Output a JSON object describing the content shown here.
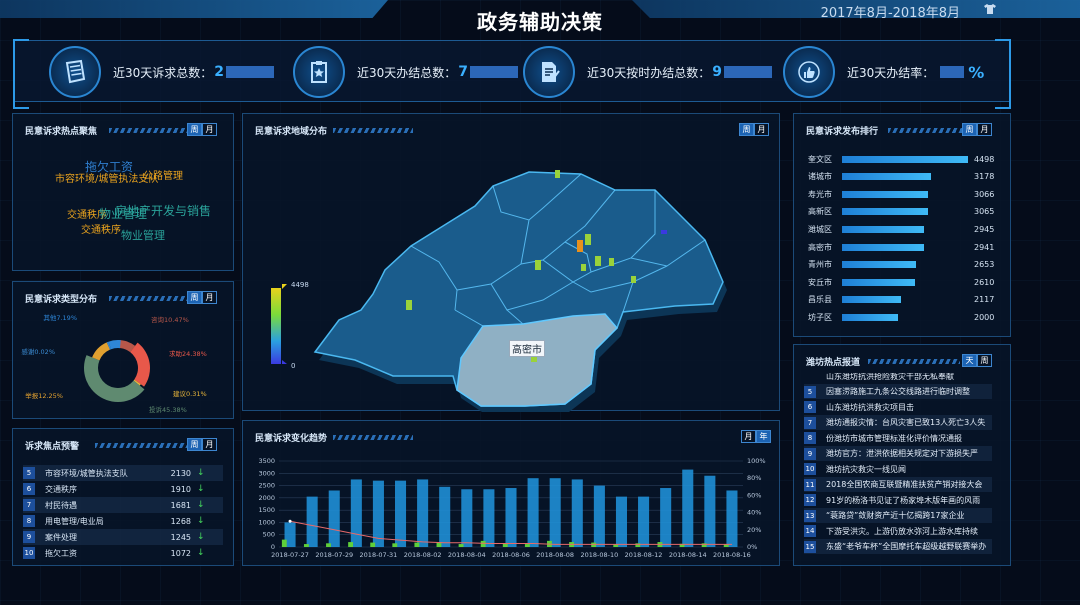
{
  "header": {
    "title": "政务辅助决策",
    "date_range": "2017年8月-2018年8月"
  },
  "stats": [
    {
      "label": "近30天诉求总数：",
      "value": "2",
      "icon": "scroll-icon"
    },
    {
      "label": "近30天办结总数：",
      "value": "7",
      "icon": "clipboard-star-icon"
    },
    {
      "label": "近30天按时办结总数：",
      "value": "9",
      "icon": "document-pen-icon"
    },
    {
      "label": "近30天办结率：",
      "value": "%",
      "icon": "thumbs-up-icon"
    }
  ],
  "hotspot": {
    "title": "民意诉求热点聚焦",
    "tabs": [
      "周",
      "月"
    ],
    "words": [
      {
        "text": "拖欠工资",
        "color": "#2f7fd0"
      },
      {
        "text": "市容环境/城管执法支队",
        "color": "#e8a21e"
      },
      {
        "text": "公路管理",
        "color": "#e8a21e"
      },
      {
        "text": "房地产开发与销售",
        "color": "#2aa39a"
      },
      {
        "text": "交通秩序",
        "color": "#e8a21e"
      },
      {
        "text": "物业管理",
        "color": "#2aa39a"
      },
      {
        "text": "交通秩序",
        "color": "#e8a21e"
      },
      {
        "text": "物业管理",
        "color": "#2aa39a"
      }
    ]
  },
  "type_dist": {
    "title": "民意诉求类型分布",
    "tabs": [
      "周",
      "月"
    ],
    "chart_data": {
      "type": "pie",
      "slices": [
        {
          "name": "咨询",
          "value": 10.47,
          "label": "咨询10.47%",
          "color": "#b8574a"
        },
        {
          "name": "求助",
          "value": 24.38,
          "label": "求助24.38%",
          "color": "#e8584a"
        },
        {
          "name": "建议",
          "value": 0.31,
          "label": "建议0.31%",
          "color": "#e8b53a"
        },
        {
          "name": "投诉",
          "value": 45.38,
          "label": "投诉45.38%",
          "color": "#5f8a70"
        },
        {
          "name": "举报",
          "value": 12.25,
          "label": "举报12.25%",
          "color": "#e0a030"
        },
        {
          "name": "感谢",
          "value": 0.02,
          "label": "感谢0.02%",
          "color": "#3a8ad0"
        },
        {
          "name": "其他",
          "value": 7.19,
          "label": "其他7.19%",
          "color": "#2e86d8"
        }
      ]
    }
  },
  "warning": {
    "title": "诉求焦点预警",
    "tabs": [
      "周",
      "月"
    ],
    "rows": [
      {
        "rank": "5",
        "name": "市容环境/城管执法支队",
        "value": "2130"
      },
      {
        "rank": "6",
        "name": "交通秩序",
        "value": "1910"
      },
      {
        "rank": "7",
        "name": "村民待遇",
        "value": "1681"
      },
      {
        "rank": "8",
        "name": "用电管理/电业局",
        "value": "1268"
      },
      {
        "rank": "9",
        "name": "案件处理",
        "value": "1245"
      },
      {
        "rank": "10",
        "name": "拖欠工资",
        "value": "1072"
      }
    ]
  },
  "map": {
    "title": "民意诉求地域分布",
    "tabs": [
      "周",
      "月"
    ],
    "legend_max": "4498",
    "legend_min": "0",
    "highlight_label": "高密市"
  },
  "trend": {
    "title": "民意诉求变化趋势",
    "tabs": [
      "月",
      "年"
    ],
    "chart_data": {
      "type": "bar",
      "x_tick_labels": [
        "2018-07-27",
        "2018-07-29",
        "2018-07-31",
        "2018-08-02",
        "2018-08-04",
        "2018-08-06",
        "2018-08-08",
        "2018-08-10",
        "2018-08-12",
        "2018-08-14",
        "2018-08-16"
      ],
      "categories": [
        "2018-07-27",
        "2018-07-28",
        "2018-07-29",
        "2018-07-30",
        "2018-07-31",
        "2018-08-01",
        "2018-08-02",
        "2018-08-03",
        "2018-08-04",
        "2018-08-05",
        "2018-08-06",
        "2018-08-07",
        "2018-08-08",
        "2018-08-09",
        "2018-08-10",
        "2018-08-11",
        "2018-08-12",
        "2018-08-13",
        "2018-08-14",
        "2018-08-15",
        "2018-08-16"
      ],
      "series": [
        {
          "type": "bar",
          "values": [
            1000,
            2050,
            2300,
            2750,
            2700,
            2700,
            2750,
            2450,
            2350,
            2350,
            2400,
            2800,
            2800,
            2750,
            2500,
            2050,
            2050,
            2400,
            3150,
            2900,
            2300
          ]
        },
        {
          "type": "bar",
          "values": [
            300,
            120,
            150,
            200,
            180,
            150,
            180,
            200,
            120,
            250,
            150,
            120,
            250,
            200,
            180,
            120,
            150,
            200,
            130,
            150,
            120
          ]
        },
        {
          "type": "line",
          "axis": "right",
          "values": [
            30,
            25,
            20,
            15,
            10,
            8,
            6,
            5,
            5,
            4,
            4,
            4,
            3,
            3,
            3,
            3,
            3,
            3,
            3,
            3,
            3
          ]
        }
      ],
      "ylim": [
        0,
        3500
      ],
      "y_ticks": [
        0,
        500,
        1000,
        1500,
        2000,
        2500,
        3000,
        3500
      ],
      "y2lim": [
        0,
        100
      ],
      "y2_ticks": [
        "0%",
        "20%",
        "40%",
        "60%",
        "80%",
        "100%"
      ],
      "colors": {
        "bar": "#1f8fd6",
        "bar2": "#5fcf3a",
        "line": "#e86a6a"
      }
    }
  },
  "ranking": {
    "title": "民意诉求发布排行",
    "tabs": [
      "周",
      "月"
    ],
    "chart_data": {
      "type": "bar",
      "orientation": "horizontal",
      "categories": [
        "奎文区",
        "诸城市",
        "寿光市",
        "高新区",
        "潍城区",
        "高密市",
        "青州市",
        "安丘市",
        "昌乐县",
        "坊子区"
      ],
      "values": [
        4498,
        3178,
        3066,
        3065,
        2945,
        2941,
        2653,
        2610,
        2117,
        2000
      ],
      "xlim": [
        0,
        4498
      ]
    }
  },
  "news": {
    "title": "潍坊热点报道",
    "tabs": [
      "天",
      "周"
    ],
    "partial_first": "山东潍坊抗洪抢险救灾干部无私奉献",
    "items": [
      {
        "rank": "5",
        "text": "因塞涝路施工九条公交线路进行临时调整"
      },
      {
        "rank": "6",
        "text": "山东潍坊抗洪救灾项目击"
      },
      {
        "rank": "7",
        "text": "潍坊通报灾情：台风灾害已致13人死亡3人失"
      },
      {
        "rank": "8",
        "text": "份潍坊市城市管理标准化评价情况通报"
      },
      {
        "rank": "9",
        "text": "潍坊官方：泄洪依据相关规定对下游损失严"
      },
      {
        "rank": "10",
        "text": "潍坊抗灾救灾一线见闻"
      },
      {
        "rank": "11",
        "text": "2018全国农商互联暨精准扶贫产销对接大会"
      },
      {
        "rank": "12",
        "text": "91岁的杨洛书见证了杨家埠木版年画的风雨"
      },
      {
        "rank": "13",
        "text": "“蓑路贷”敛财资产近十亿揭跨17家企业"
      },
      {
        "rank": "14",
        "text": "下游受洪灾。上游仍放水弥河上游水库持续"
      },
      {
        "rank": "15",
        "text": "东盛“老爷车杯”全国摩托车超级越野联赛举办"
      }
    ]
  }
}
